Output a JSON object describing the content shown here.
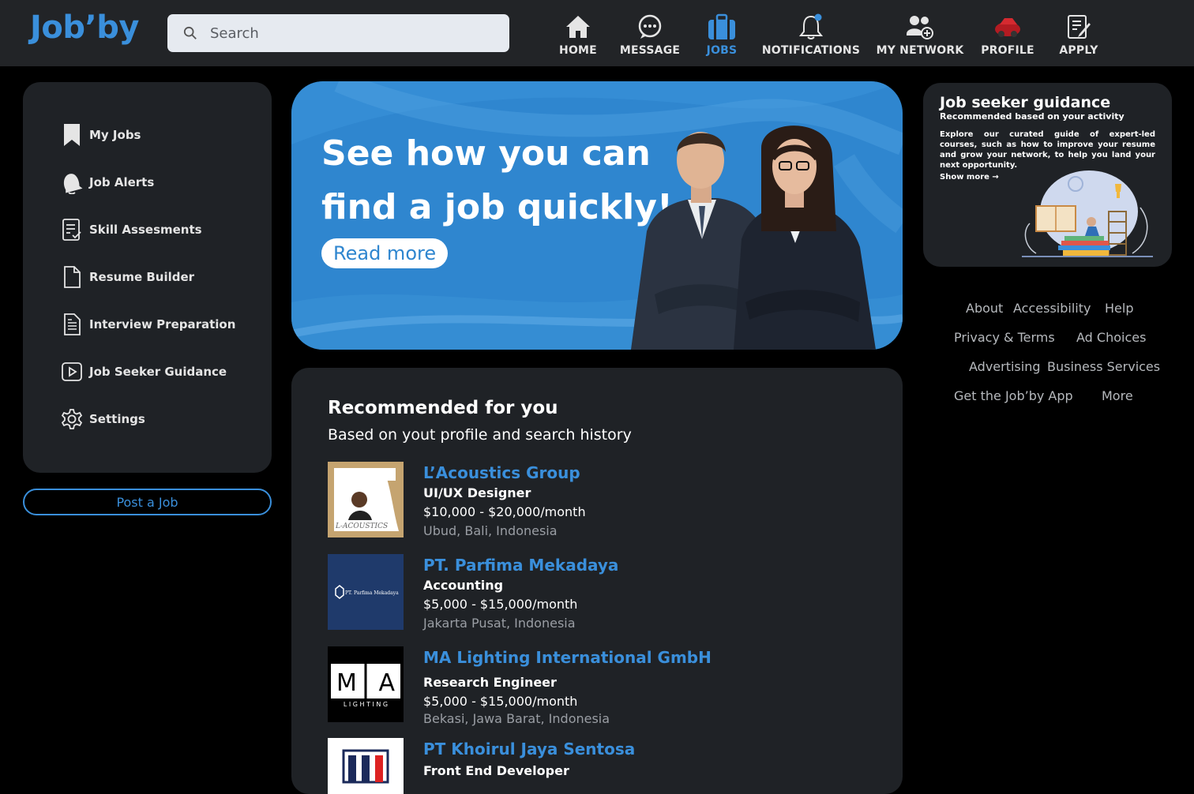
{
  "app": {
    "logo": "Job’by"
  },
  "search": {
    "placeholder": "Search"
  },
  "nav": [
    {
      "label": "HOME",
      "icon": "home-icon"
    },
    {
      "label": "MESSAGE",
      "icon": "message-icon"
    },
    {
      "label": "JOBS",
      "icon": "briefcase-icon",
      "active": true
    },
    {
      "label": "NOTIFICATIONS",
      "icon": "bell-icon"
    },
    {
      "label": "MY NETWORK",
      "icon": "network-icon"
    },
    {
      "label": "PROFILE",
      "icon": "profile-avatar-icon"
    },
    {
      "label": "APPLY",
      "icon": "apply-icon"
    }
  ],
  "sidebar": {
    "items": [
      {
        "label": "My Jobs",
        "icon": "bookmark-icon"
      },
      {
        "label": "Job Alerts",
        "icon": "bell-icon"
      },
      {
        "label": "Skill Assesments",
        "icon": "checklist-icon"
      },
      {
        "label": "Resume Builder",
        "icon": "document-icon"
      },
      {
        "label": "Interview Preparation",
        "icon": "notes-icon"
      },
      {
        "label": "Job Seeker Guidance",
        "icon": "play-icon"
      },
      {
        "label": "Settings",
        "icon": "gear-icon"
      }
    ],
    "post_job": "Post a Job"
  },
  "banner": {
    "line1": "See how you can",
    "line2": "find a job quickly!",
    "cta": "Read more"
  },
  "recommended": {
    "title": "Recommended for you",
    "subtitle": "Based on yout profile and search history",
    "jobs": [
      {
        "company": "L’Acoustics  Group",
        "role": "UI/UX Designer",
        "salary": "$10,000 - $20,000/month",
        "location": "Ubud, Bali, Indonesia",
        "logo_text": "L-ACOUSTICS"
      },
      {
        "company": "PT. Parfima Mekadaya",
        "role": "Accounting",
        "salary": "$5,000 - $15,000/month",
        "location": "Jakarta Pusat, Indonesia",
        "logo_text": "PT. Parfima Mekadaya"
      },
      {
        "company": "MA Lighting International GmbH",
        "role": "Research Engineer",
        "salary": "$5,000 - $15,000/month",
        "location": "Bekasi, Jawa Barat, Indonesia",
        "logo_text": "M A",
        "logo_sub": "L I G H T I N G"
      },
      {
        "company": "PT Khoirul Jaya Sentosa",
        "role": "Front End Developer",
        "salary": "",
        "location": ""
      }
    ]
  },
  "guidance": {
    "title": "Job seeker guidance",
    "subtitle": "Recommended based on your activity",
    "text": "Explore our curated guide of expert-led courses, such as how to improve your resume and grow your network, to help you land your next opportunity.",
    "more": "Show more →"
  },
  "footer": {
    "links": [
      "About",
      "Accessibility",
      "Help",
      "Privacy & Terms",
      "Ad Choices",
      "Advertising",
      "Business Services",
      "Get the Job’by App",
      "More"
    ]
  },
  "colors": {
    "accent": "#3a8fdb",
    "panel": "#1f2226",
    "topbar": "#222427",
    "banner": "#2f86cf"
  }
}
